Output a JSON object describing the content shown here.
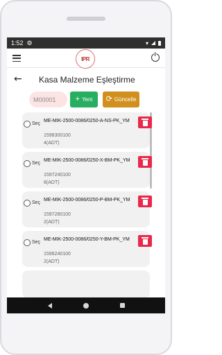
{
  "status": {
    "time": "1:52"
  },
  "app": {
    "logo_text": "IPR"
  },
  "page": {
    "title": "Kasa Malzeme Eşleştirme"
  },
  "search": {
    "value": "M00001"
  },
  "buttons": {
    "new_label": "Yeni",
    "update_label": "Güncelle"
  },
  "list": {
    "select_label": "Seç",
    "items": [
      {
        "code": "ME-MIK-2500-0086/0250-A-NS-PK_YM",
        "number": "1598300100",
        "quantity": "4(ADT)"
      },
      {
        "code": "ME-MIK-2500-0086/0250-X-BM-PK_YM",
        "number": "1597240100",
        "quantity": "8(ADT)"
      },
      {
        "code": "ME-MIK-2500-0086/0250-P-BM-PK_YM",
        "number": "1597280100",
        "quantity": "2(ADT)"
      },
      {
        "code": "ME-MIK-2500-0086/0250-Y-BM-PK_YM",
        "number": "1599240100",
        "quantity": "2(ADT)"
      }
    ]
  },
  "colors": {
    "new_button": "#27ae60",
    "update_button": "#d1901e",
    "delete_button": "#e8294b",
    "input_bg": "#fde4e4"
  }
}
